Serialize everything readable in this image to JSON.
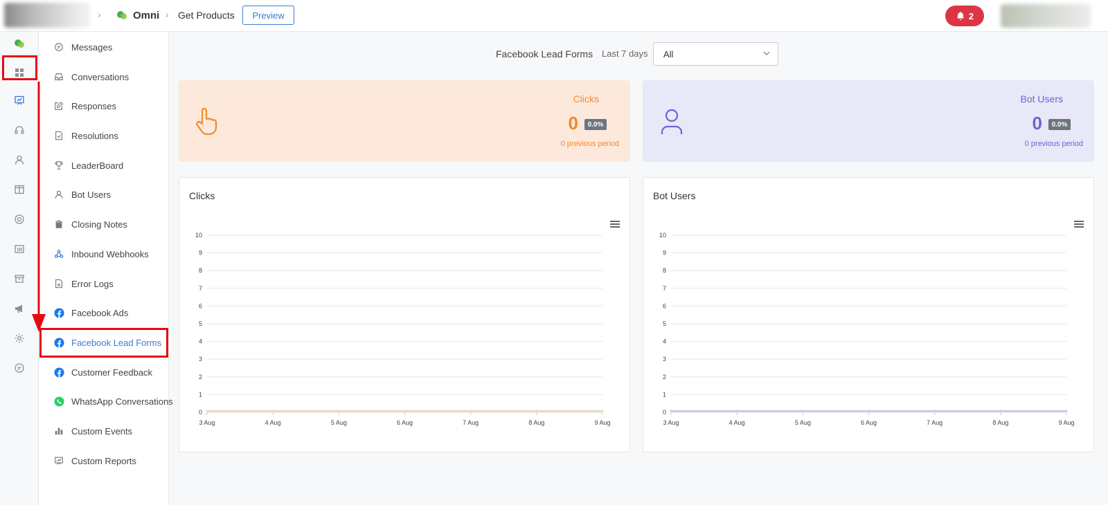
{
  "breadcrumb": {
    "app": "Omni",
    "page": "Get Products"
  },
  "header": {
    "preview_label": "Preview",
    "notifications_count": "2"
  },
  "rail": {
    "icons": [
      "omni-chat-icon",
      "grid-icon",
      "presentation-icon",
      "headset-icon",
      "user-icon",
      "columns-icon",
      "lifebuoy-icon",
      "table-icon",
      "archive-icon",
      "megaphone-icon",
      "gear-icon",
      "chat-bubble-icon"
    ],
    "active_icon": "presentation-icon"
  },
  "menu": {
    "items": [
      {
        "label": "Messages",
        "icon": "message-icon"
      },
      {
        "label": "Conversations",
        "icon": "inbox-icon"
      },
      {
        "label": "Responses",
        "icon": "edit-icon"
      },
      {
        "label": "Resolutions",
        "icon": "file-check-icon"
      },
      {
        "label": "LeaderBoard",
        "icon": "trophy-icon"
      },
      {
        "label": "Bot Users",
        "icon": "user-icon"
      },
      {
        "label": "Closing Notes",
        "icon": "clipboard-icon"
      },
      {
        "label": "Inbound Webhooks",
        "icon": "webhook-icon"
      },
      {
        "label": "Error Logs",
        "icon": "file-x-icon"
      },
      {
        "label": "Facebook Ads",
        "icon": "facebook-icon"
      },
      {
        "label": "Facebook Lead Forms",
        "icon": "facebook-icon"
      },
      {
        "label": "Customer Feedback",
        "icon": "facebook-icon"
      },
      {
        "label": "WhatsApp Conversations",
        "icon": "whatsapp-icon"
      },
      {
        "label": "Custom Events",
        "icon": "bar-chart-icon"
      },
      {
        "label": "Custom Reports",
        "icon": "presentation-icon"
      }
    ],
    "active": "Facebook Lead Forms"
  },
  "filter": {
    "title": "Facebook Lead Forms",
    "period": "Last 7 days",
    "select_value": "All"
  },
  "stats": {
    "clicks": {
      "title": "Clicks",
      "value": "0",
      "change": "0.0%",
      "previous": "0 previous period",
      "color": "#f08a2b"
    },
    "bot_users": {
      "title": "Bot Users",
      "value": "0",
      "change": "0.0%",
      "previous": "0 previous period",
      "color": "#6c63d6"
    }
  },
  "chart_data": [
    {
      "type": "area",
      "title": "Clicks",
      "categories": [
        "3 Aug",
        "4 Aug",
        "5 Aug",
        "6 Aug",
        "7 Aug",
        "8 Aug",
        "9 Aug"
      ],
      "series": [
        {
          "values": [
            0,
            0,
            0,
            0,
            0,
            0,
            0
          ]
        }
      ],
      "ylim": [
        0,
        10
      ],
      "yticks": [
        "0",
        "1",
        "2",
        "3",
        "4",
        "5",
        "6",
        "7",
        "8",
        "9",
        "10"
      ],
      "grid": true,
      "color": "#e8d8c4"
    },
    {
      "type": "area",
      "title": "Bot Users",
      "categories": [
        "3 Aug",
        "4 Aug",
        "5 Aug",
        "6 Aug",
        "7 Aug",
        "8 Aug",
        "9 Aug"
      ],
      "series": [
        {
          "values": [
            0,
            0,
            0,
            0,
            0,
            0,
            0
          ]
        }
      ],
      "ylim": [
        0,
        10
      ],
      "yticks": [
        "0",
        "1",
        "2",
        "3",
        "4",
        "5",
        "6",
        "7",
        "8",
        "9",
        "10"
      ],
      "grid": true,
      "color": "#c9c7ec"
    }
  ]
}
